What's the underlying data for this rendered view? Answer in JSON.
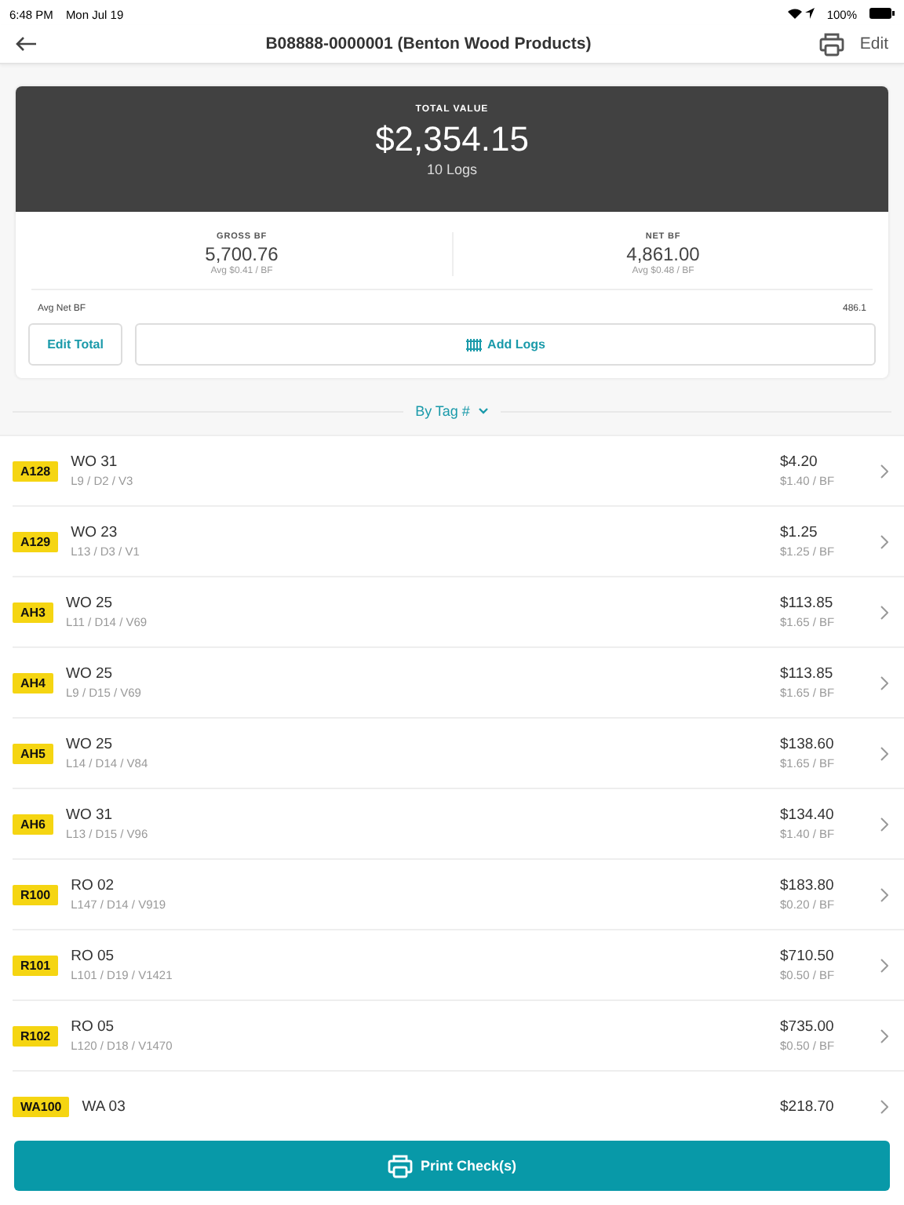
{
  "status_bar": {
    "time": "6:48 PM",
    "date": "Mon Jul 19",
    "battery": "100%"
  },
  "header": {
    "title": "B08888-0000001 (Benton Wood Products)",
    "edit": "Edit"
  },
  "summary": {
    "total_label": "TOTAL VALUE",
    "total": "$2,354.15",
    "logs": "10 Logs",
    "stats": [
      {
        "label": "GROSS BF",
        "value": "5,700.76",
        "avg": "Avg $0.41 / BF"
      },
      {
        "label": "NET BF",
        "value": "4,861.00",
        "avg": "Avg $0.48 / BF"
      }
    ],
    "avg_net_label": "Avg Net BF",
    "avg_net_value": "486.1",
    "edit_total": "Edit Total",
    "add_logs": "Add Logs"
  },
  "sort": {
    "label": "By Tag #"
  },
  "logs": [
    {
      "tag": "A128",
      "species": "WO 31",
      "dims": "L9 / D2 / V3",
      "price": "$4.20",
      "per_bf": "$1.40 / BF"
    },
    {
      "tag": "A129",
      "species": "WO 23",
      "dims": "L13 / D3 / V1",
      "price": "$1.25",
      "per_bf": "$1.25 / BF"
    },
    {
      "tag": "AH3",
      "species": "WO 25",
      "dims": "L11 / D14 / V69",
      "price": "$113.85",
      "per_bf": "$1.65 / BF"
    },
    {
      "tag": "AH4",
      "species": "WO 25",
      "dims": "L9 / D15 / V69",
      "price": "$113.85",
      "per_bf": "$1.65 / BF"
    },
    {
      "tag": "AH5",
      "species": "WO 25",
      "dims": "L14 / D14 / V84",
      "price": "$138.60",
      "per_bf": "$1.65 / BF"
    },
    {
      "tag": "AH6",
      "species": "WO 31",
      "dims": "L13 / D15 / V96",
      "price": "$134.40",
      "per_bf": "$1.40 / BF"
    },
    {
      "tag": "R100",
      "species": "RO 02",
      "dims": "L147 / D14 / V919",
      "price": "$183.80",
      "per_bf": "$0.20 / BF"
    },
    {
      "tag": "R101",
      "species": "RO 05",
      "dims": "L101 / D19 / V1421",
      "price": "$710.50",
      "per_bf": "$0.50 / BF"
    },
    {
      "tag": "R102",
      "species": "RO 05",
      "dims": "L120 / D18 / V1470",
      "price": "$735.00",
      "per_bf": "$0.50 / BF"
    },
    {
      "tag": "WA100",
      "species": "WA 03",
      "price": "$218.70"
    }
  ],
  "footer": {
    "button": "Print Check(s)"
  }
}
